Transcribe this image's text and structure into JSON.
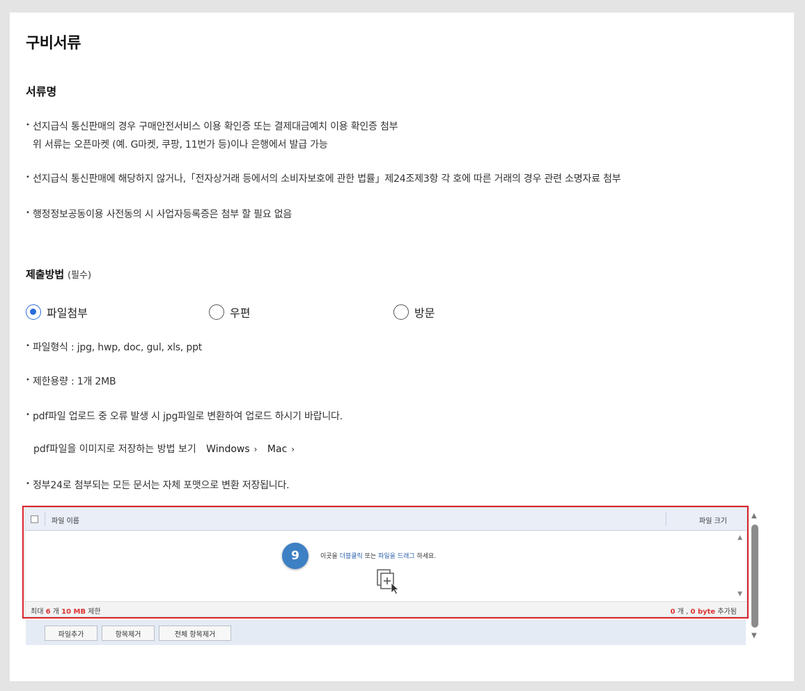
{
  "section_title": "구비서류",
  "doc_name_label": "서류명",
  "bullets": [
    {
      "line1": "선지급식 통신판매의 경우 구매안전서비스 이용 확인증 또는 결제대금예치 이용 확인증 첨부",
      "line2": "위 서류는 오픈마켓 (예. G마켓, 쿠팡, 11번가 등)이나 은행에서 발급 가능"
    },
    {
      "line1": "선지급식 통신판매에 해당하지 않거나,「전자상거래 등에서의 소비자보호에 관한 법률」제24조제3항 각 호에 따른 거래의 경우 관련 소명자료 첨부"
    },
    {
      "line1": "행정정보공동이용 사전동의 시 사업자등록증은 첨부 할 필요 없음"
    }
  ],
  "submit": {
    "title": "제출방법",
    "required": "(필수)"
  },
  "radios": [
    {
      "label": "파일첨부",
      "checked": true
    },
    {
      "label": "우편",
      "checked": false
    },
    {
      "label": "방문",
      "checked": false
    }
  ],
  "file_bullets": [
    "파일형식 : jpg, hwp, doc, gul, xls, ppt",
    "제한용량 : 1개 2MB",
    "pdf파일 업로드 중 오류 발생 시 jpg파일로 변환하여 업로드 하시기 바랍니다."
  ],
  "pdf_help": {
    "text": "pdf파일을 이미지로 저장하는 방법 보기",
    "link_windows": "Windows",
    "link_mac": "Mac",
    "chevron": "›"
  },
  "last_bullet": "정부24로 첨부되는 모든 문서는 자체 포맷으로 변환 저장됩니다.",
  "uploader": {
    "col_name": "파일 이름",
    "col_size": "파일 크기",
    "badge": "9",
    "drop_prefix": "이곳을 ",
    "drop_dbl": "더블클릭",
    "drop_mid": " 또는 ",
    "drop_drag": "파일을 드래그",
    "drop_suffix": " 하세요.",
    "foot_max_prefix": "최대 ",
    "foot_max_count": "6",
    "foot_max_mid": " 개 ",
    "foot_max_size": "10 MB",
    "foot_max_suffix": " 제한",
    "foot_count": "0",
    "foot_count_unit": " 개 , ",
    "foot_bytes": "0 byte",
    "foot_added": " 추가됨"
  },
  "buttons": {
    "add": "파일추가",
    "remove": "항목제거",
    "remove_all": "전체 항목제거"
  },
  "colors": {
    "accent": "#2b6bdc",
    "badge": "#3e80c4",
    "highlight_box": "#d9232d"
  }
}
